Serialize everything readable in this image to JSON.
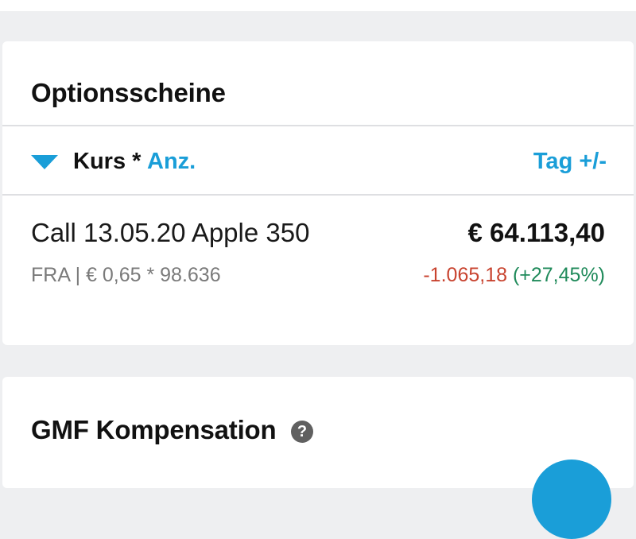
{
  "colors": {
    "accent": "#1a9ed8",
    "negative": "#c8432f",
    "positive": "#1f8a5a",
    "background": "#eeeff1",
    "card": "#ffffff"
  },
  "options_section": {
    "title": "Optionsscheine",
    "sort": {
      "icon": "triangle-down-icon",
      "label": "Kurs *",
      "alt_label": "Anz.",
      "right_label": "Tag +/-"
    },
    "position": {
      "name": "Call 13.05.20 Apple 350",
      "value": "€ 64.113,40",
      "meta": "FRA | € 0,65 * 98.636",
      "change_abs": "-1.065,18",
      "change_pct": "(+27,45%)"
    }
  },
  "gmf_section": {
    "title": "GMF Kompensation",
    "help_icon": "question-mark-icon",
    "help_glyph": "?"
  },
  "fab": {
    "icon": "fab-button"
  }
}
